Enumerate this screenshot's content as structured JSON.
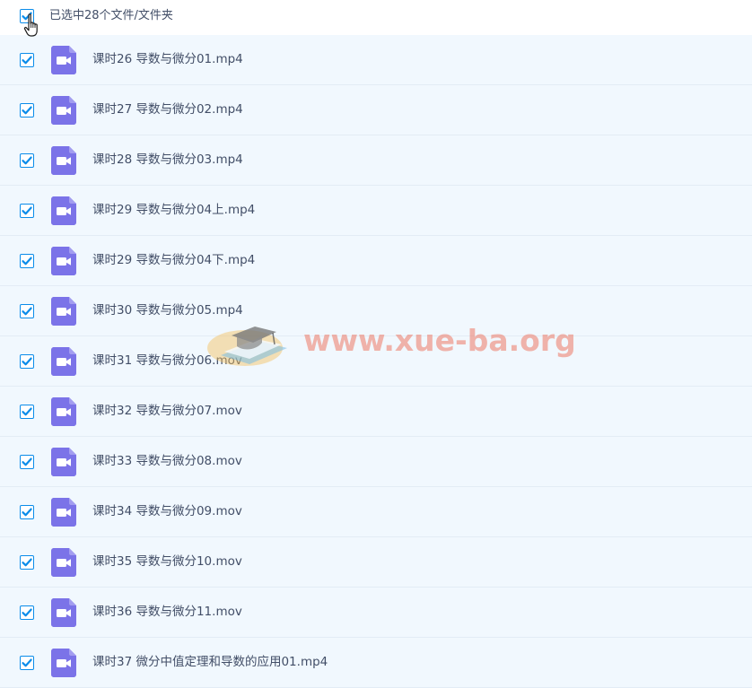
{
  "header": {
    "selection_label": "已选中28个文件/文件夹",
    "checked": true
  },
  "files": [
    {
      "name": "课时26 导数与微分01.mp4",
      "checked": true,
      "icon": "video-file-icon"
    },
    {
      "name": "课时27 导数与微分02.mp4",
      "checked": true,
      "icon": "video-file-icon"
    },
    {
      "name": "课时28 导数与微分03.mp4",
      "checked": true,
      "icon": "video-file-icon"
    },
    {
      "name": "课时29 导数与微分04上.mp4",
      "checked": true,
      "icon": "video-file-icon"
    },
    {
      "name": "课时29 导数与微分04下.mp4",
      "checked": true,
      "icon": "video-file-icon"
    },
    {
      "name": "课时30 导数与微分05.mp4",
      "checked": true,
      "icon": "video-file-icon"
    },
    {
      "name": "课时31 导数与微分06.mov",
      "checked": true,
      "icon": "video-file-icon"
    },
    {
      "name": "课时32 导数与微分07.mov",
      "checked": true,
      "icon": "video-file-icon"
    },
    {
      "name": "课时33 导数与微分08.mov",
      "checked": true,
      "icon": "video-file-icon"
    },
    {
      "name": "课时34 导数与微分09.mov",
      "checked": true,
      "icon": "video-file-icon"
    },
    {
      "name": "课时35 导数与微分10.mov",
      "checked": true,
      "icon": "video-file-icon"
    },
    {
      "name": "课时36 导数与微分11.mov",
      "checked": true,
      "icon": "video-file-icon"
    },
    {
      "name": "课时37 微分中值定理和导数的应用01.mp4",
      "checked": true,
      "icon": "video-file-icon"
    }
  ],
  "watermark": {
    "text": "www.xue-ba.org"
  },
  "colors": {
    "row_background": "#f1f8fe",
    "checkbox_accent": "#0a8cea",
    "file_icon": "#7b73e8",
    "text": "#424e67"
  }
}
